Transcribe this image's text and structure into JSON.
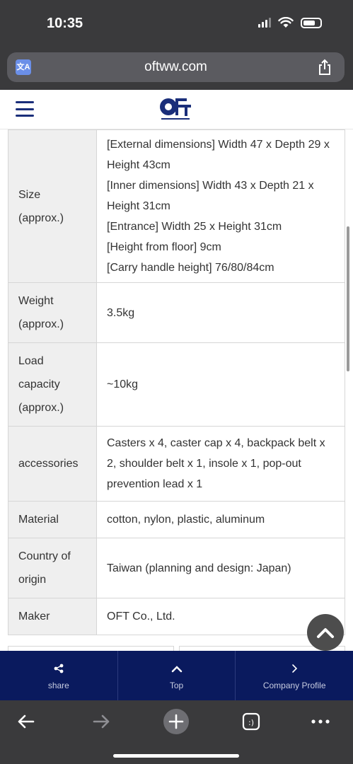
{
  "status": {
    "time": "10:35"
  },
  "browser": {
    "url": "oftww.com"
  },
  "site": {
    "logo_text": "OFT"
  },
  "spec_table": {
    "size": {
      "label_line1": "Size",
      "label_line2": "(approx.)",
      "lines": [
        "[External dimensions] Width 47 x Depth 29 x Height 43cm",
        "[Inner dimensions] Width 43 x Depth 21 x Height 31cm",
        "[Entrance] Width 25 x Height 31cm",
        "[Height from floor] 9cm",
        "[Carry handle height] 76/80/84cm"
      ]
    },
    "weight": {
      "label_line1": "Weight",
      "label_line2": "(approx.)",
      "value": "3.5kg"
    },
    "load": {
      "label_line1": "Load",
      "label_line2": "capacity",
      "label_line3": "(approx.)",
      "value": "~10kg"
    },
    "accessories": {
      "label": "accessories",
      "value": "Casters x 4, caster cap x 4, backpack belt x 2, shoulder belt x 1, insole x 1, pop-out prevention lead x 1"
    },
    "material": {
      "label": "Material",
      "value": "cotton, nylon, plastic, aluminum"
    },
    "country": {
      "label_line1": "Country of",
      "label_line2": "origin",
      "value": "Taiwan (planning and design: Japan)"
    },
    "maker": {
      "label": "Maker",
      "value": "OFT Co., Ltd."
    }
  },
  "bottom_nav": {
    "share": "share",
    "top": "Top",
    "company": "Company Profile"
  },
  "colors": {
    "nav_bg": "#0a1a5e",
    "chrome_bg": "#3a3a3c",
    "label_cell_bg": "#efefef"
  }
}
